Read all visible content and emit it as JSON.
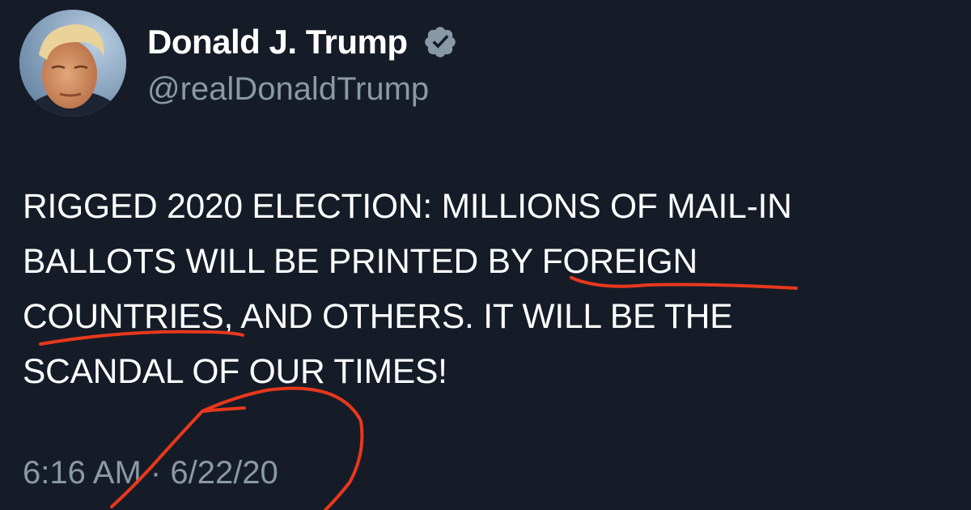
{
  "author": {
    "display_name": "Donald J. Trump",
    "handle": "@realDonaldTrump",
    "verified": true,
    "avatar_icon": "profile-photo"
  },
  "tweet": {
    "lines": [
      "RIGGED 2020 ELECTION: MILLIONS OF MAIL-IN",
      "BALLOTS WILL BE PRINTED BY FOREIGN",
      "COUNTRIES, AND OTHERS. IT WILL BE THE",
      "SCANDAL OF OUR TIMES!"
    ],
    "time": "6:16 AM",
    "separator": "·",
    "date": "6/22/20"
  },
  "colors": {
    "background": "#151c28",
    "text": "#ffffff",
    "secondary_text": "#8b98a5",
    "verified_badge": "#8899a6",
    "annotation": "#e8381c"
  }
}
